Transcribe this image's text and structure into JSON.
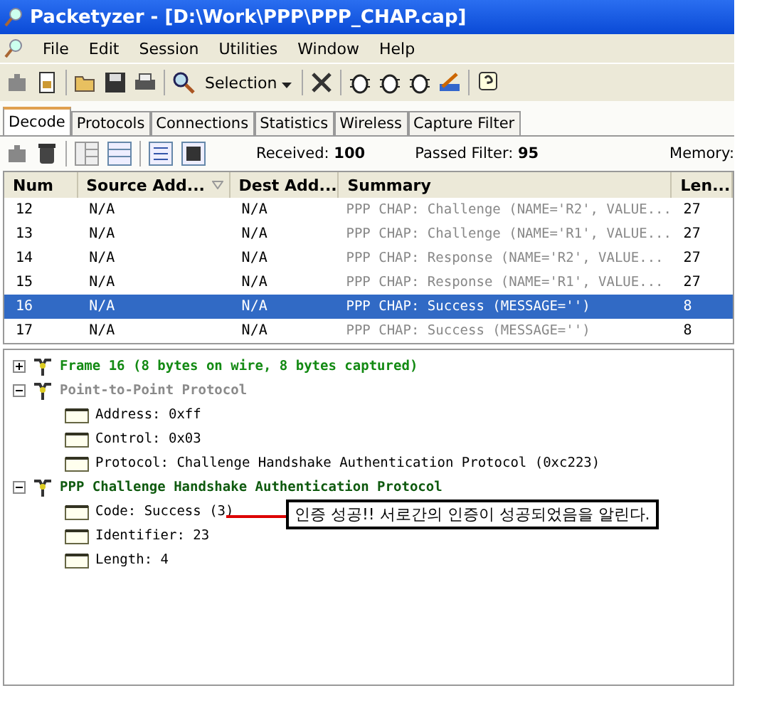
{
  "window": {
    "title": "Packetyzer - [D:\\Work\\PPP\\PPP_CHAP.cap]"
  },
  "menu": [
    "File",
    "Edit",
    "Session",
    "Utilities",
    "Window",
    "Help"
  ],
  "toolbar": {
    "selection": "Selection"
  },
  "tabs": [
    {
      "label": "Decode",
      "selected": true
    },
    {
      "label": "Protocols",
      "selected": false
    },
    {
      "label": "Connections",
      "selected": false
    },
    {
      "label": "Statistics",
      "selected": false
    },
    {
      "label": "Wireless",
      "selected": false
    },
    {
      "label": "Capture Filter",
      "selected": false
    }
  ],
  "stats": {
    "received_label": "Received:",
    "received": "100",
    "passed_label": "Passed Filter:",
    "passed": "95",
    "memory_label": "Memory:"
  },
  "table": {
    "columns": [
      "Num",
      "Source Add...",
      "Dest Add...",
      "Summary",
      "Len..."
    ],
    "rows": [
      {
        "cells": [
          "12",
          "N/A",
          "N/A",
          "PPP CHAP: Challenge (NAME='R2', VALUE...",
          "27"
        ],
        "selected": false
      },
      {
        "cells": [
          "13",
          "N/A",
          "N/A",
          "PPP CHAP: Challenge (NAME='R1', VALUE...",
          "27"
        ],
        "selected": false
      },
      {
        "cells": [
          "14",
          "N/A",
          "N/A",
          "PPP CHAP: Response (NAME='R2', VALUE...",
          "27"
        ],
        "selected": false
      },
      {
        "cells": [
          "15",
          "N/A",
          "N/A",
          "PPP CHAP: Response (NAME='R1', VALUE...",
          "27"
        ],
        "selected": false
      },
      {
        "cells": [
          "16",
          "N/A",
          "N/A",
          "PPP CHAP: Success (MESSAGE='')",
          "8"
        ],
        "selected": true
      },
      {
        "cells": [
          "17",
          "N/A",
          "N/A",
          "PPP CHAP: Success (MESSAGE='')",
          "8"
        ],
        "selected": false
      }
    ]
  },
  "tree": [
    {
      "label": "Frame 16 (8 bytes on wire, 8 bytes captured)",
      "kind": "frame",
      "expanded": false
    },
    {
      "label": "Point-to-Point Protocol",
      "kind": "layer",
      "expanded": true,
      "children": [
        {
          "label": "Address: 0xff"
        },
        {
          "label": "Control: 0x03"
        },
        {
          "label": "Protocol: Challenge Handshake Authentication Protocol (0xc223)"
        }
      ]
    },
    {
      "label": "PPP Challenge Handshake Authentication Protocol",
      "kind": "protocol",
      "expanded": true,
      "children": [
        {
          "label": "Code: Success (3)",
          "note": "인증 성공!! 서로간의 인증이 성공되었음을 알린다."
        },
        {
          "label": "Identifier: 23"
        },
        {
          "label": "Length: 4"
        }
      ]
    }
  ]
}
